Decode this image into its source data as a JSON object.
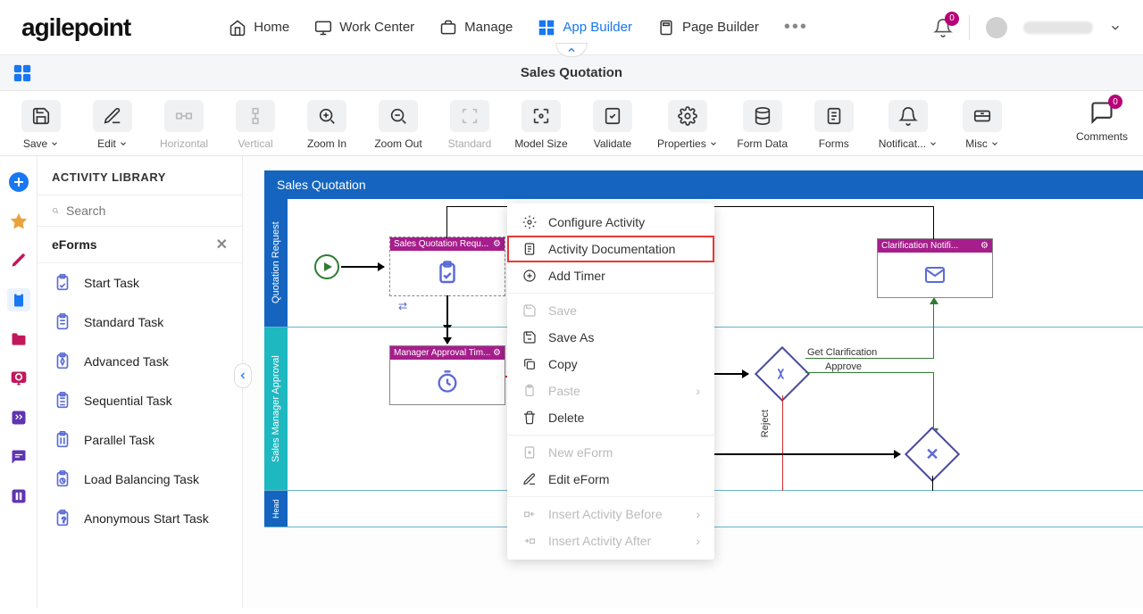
{
  "topnav": {
    "items": [
      {
        "label": "Home",
        "icon": "home-icon"
      },
      {
        "label": "Work Center",
        "icon": "monitor-icon"
      },
      {
        "label": "Manage",
        "icon": "briefcase-icon"
      },
      {
        "label": "App Builder",
        "icon": "grid-icon",
        "active": true
      },
      {
        "label": "Page Builder",
        "icon": "page-icon"
      }
    ],
    "notifications_count": "0",
    "logo_text": "agilepoint"
  },
  "subheader": {
    "title": "Sales Quotation"
  },
  "toolbar": {
    "buttons": [
      {
        "label": "Save",
        "icon": "save-icon",
        "dropdown": true
      },
      {
        "label": "Edit",
        "icon": "edit-icon",
        "dropdown": true
      },
      {
        "label": "Horizontal",
        "icon": "align-h-icon",
        "disabled": true
      },
      {
        "label": "Vertical",
        "icon": "align-v-icon",
        "disabled": true
      },
      {
        "label": "Zoom In",
        "icon": "zoom-in-icon"
      },
      {
        "label": "Zoom Out",
        "icon": "zoom-out-icon"
      },
      {
        "label": "Standard",
        "icon": "fit-std-icon",
        "disabled": true
      },
      {
        "label": "Model Size",
        "icon": "fit-model-icon"
      },
      {
        "label": "Validate",
        "icon": "validate-icon"
      },
      {
        "label": "Properties",
        "icon": "gear-icon",
        "dropdown": true
      },
      {
        "label": "Form Data",
        "icon": "db-icon"
      },
      {
        "label": "Forms",
        "icon": "form-icon"
      },
      {
        "label": "Notificat...",
        "icon": "bell-icon",
        "dropdown": true
      },
      {
        "label": "Misc",
        "icon": "drawer-icon",
        "dropdown": true
      }
    ],
    "comments_label": "Comments",
    "comments_count": "0"
  },
  "sidebar": {
    "header": "ACTIVITY LIBRARY",
    "search_placeholder": "Search",
    "category": "eForms",
    "items": [
      {
        "label": "Start Task"
      },
      {
        "label": "Standard Task"
      },
      {
        "label": "Advanced Task"
      },
      {
        "label": "Sequential Task"
      },
      {
        "label": "Parallel Task"
      },
      {
        "label": "Load Balancing Task"
      },
      {
        "label": "Anonymous Start Task"
      }
    ]
  },
  "canvas": {
    "process_title": "Sales Quotation",
    "lanes": [
      {
        "label": "Quotation Request"
      },
      {
        "label": "Sales Manager Approval"
      },
      {
        "label": "Head"
      }
    ],
    "activities": {
      "start_task": "Sales Quotation Requ...",
      "manager_task": "Manager Approval Tim...",
      "clarification": "Clarification Notifi...",
      "gateway_labels": {
        "get_clarification": "Get Clarification",
        "approve": "Approve",
        "reject": "Reject"
      }
    }
  },
  "context_menu": {
    "items": [
      {
        "label": "Configure Activity",
        "icon": "gear-icon"
      },
      {
        "label": "Activity Documentation",
        "icon": "doc-icon",
        "highlight": true
      },
      {
        "label": "Add Timer",
        "icon": "plus-circle-icon"
      },
      {
        "sep": true
      },
      {
        "label": "Save",
        "icon": "save-icon",
        "disabled": true
      },
      {
        "label": "Save As",
        "icon": "save-as-icon"
      },
      {
        "label": "Copy",
        "icon": "copy-icon"
      },
      {
        "label": "Paste",
        "icon": "paste-icon",
        "disabled": true,
        "submenu": true
      },
      {
        "label": "Delete",
        "icon": "trash-icon"
      },
      {
        "sep": true
      },
      {
        "label": "New eForm",
        "icon": "new-form-icon",
        "disabled": true
      },
      {
        "label": "Edit eForm",
        "icon": "edit-icon"
      },
      {
        "sep": true
      },
      {
        "label": "Insert Activity Before",
        "icon": "insert-before-icon",
        "disabled": true,
        "submenu": true
      },
      {
        "label": "Insert Activity After",
        "icon": "insert-after-icon",
        "disabled": true,
        "submenu": true
      }
    ]
  }
}
